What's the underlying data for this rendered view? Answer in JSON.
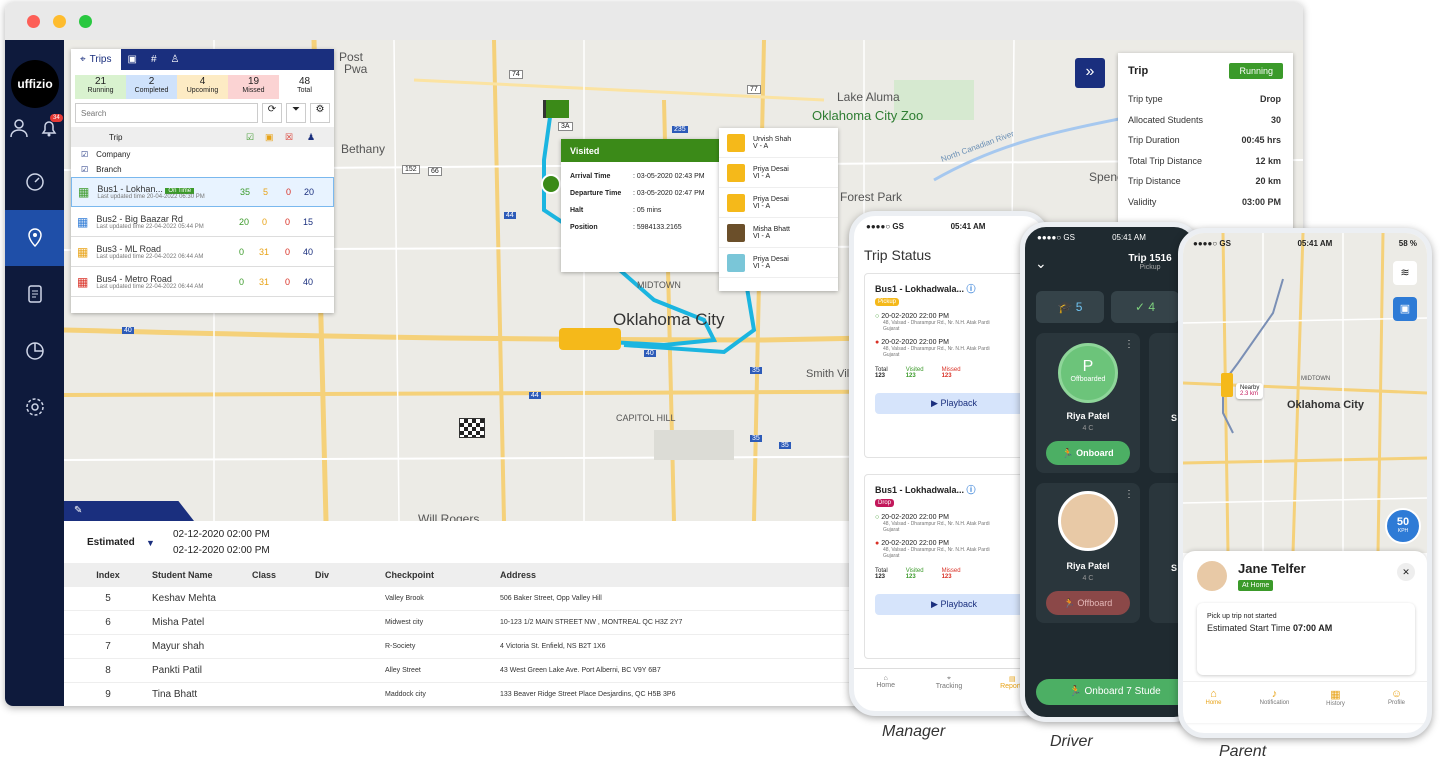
{
  "brand": {
    "name": "uffizio"
  },
  "sidebar": {
    "alerts_count": "34"
  },
  "trips_panel": {
    "tab": "Trips",
    "stats": [
      {
        "value": "21",
        "label": "Running",
        "bg": "#d9f2cf"
      },
      {
        "value": "2",
        "label": "Completed",
        "bg": "#cfe2fb"
      },
      {
        "value": "4",
        "label": "Upcoming",
        "bg": "#fdebc4"
      },
      {
        "value": "19",
        "label": "Missed",
        "bg": "#fbd3d3"
      },
      {
        "value": "48",
        "label": "Total",
        "bg": "#ffffff"
      }
    ],
    "search_placeholder": "Search",
    "col_trip": "Trip",
    "group1": "Company",
    "group2": "Branch",
    "trips": [
      {
        "name": "Bus1 - Lokhan...",
        "badge": "On Time",
        "updated": "Last updated time  20-04-2022 06:30 PM",
        "v": "35",
        "u": "5",
        "m": "0",
        "t": "20",
        "color": "#3b9a2a"
      },
      {
        "name": "Bus2 - Big Baazar Rd",
        "updated": "Last updated time  22-04-2022 05:44 PM",
        "v": "20",
        "u": "0",
        "m": "0",
        "t": "15",
        "color": "#2e7bd6"
      },
      {
        "name": "Bus3 - ML Road",
        "updated": "Last updated time  22-04-2022 06:44 AM",
        "v": "0",
        "u": "31",
        "m": "0",
        "t": "40",
        "color": "#e8a317"
      },
      {
        "name": "Bus4 - Metro Road",
        "updated": "Last updated time  22-04-2022 06:44 AM",
        "v": "0",
        "u": "31",
        "m": "0",
        "t": "40",
        "color": "#d93025"
      }
    ]
  },
  "map": {
    "labels": [
      "Post",
      "Pwa",
      "Lake Aluma",
      "Oklahoma City Zoo",
      "Bethany",
      "North Canadian River",
      "Spencer",
      "Forest Park",
      "MIDTOWN",
      "Oklahoma City",
      "Smith Villa",
      "CAPITOL HILL",
      "Will Rogers"
    ],
    "shields": [
      "74",
      "77",
      "44",
      "3A",
      "235",
      "152",
      "66",
      "62",
      "40",
      "44",
      "40",
      "35",
      "40",
      "35",
      "35"
    ]
  },
  "visited": {
    "title": "Visited",
    "rows": [
      {
        "k": "Arrival Time",
        "v": ": 03-05-2020 02:43 PM"
      },
      {
        "k": "Departure Time",
        "v": ": 03-05-2020 02:47 PM"
      },
      {
        "k": "Halt",
        "v": ": 05 mins"
      },
      {
        "k": "Position",
        "v": ": 5984133.2165"
      }
    ]
  },
  "students_popup": [
    {
      "name": "Urvish Shah",
      "cls": "V - A"
    },
    {
      "name": "Priya Desai",
      "cls": "VI - A"
    },
    {
      "name": "Priya Desai",
      "cls": "VI - A"
    },
    {
      "name": "Misha Bhatt",
      "cls": "VI - A"
    },
    {
      "name": "Priya Desai",
      "cls": "VI - A"
    }
  ],
  "trip_info": {
    "title": "Trip",
    "status": "Running",
    "rows": [
      {
        "k": "Trip type",
        "v": "Drop"
      },
      {
        "k": "Allocated Students",
        "v": "30"
      },
      {
        "k": "Trip Duration",
        "v": "00:45 hrs"
      },
      {
        "k": "Total Trip Distance",
        "v": "12 km"
      },
      {
        "k": "Trip Distance",
        "v": "20 km"
      },
      {
        "k": "Validity",
        "v": "03:00 PM"
      }
    ]
  },
  "bottom": {
    "estimated": "Estimated",
    "time1": "02-12-2020 02:00 PM",
    "time2": "02-12-2020 02:00 PM",
    "headers": [
      "Index",
      "Student Name",
      "Class",
      "Div",
      "Checkpoint",
      "Address"
    ],
    "rows": [
      {
        "i": "5",
        "n": "Keshav Mehta",
        "cp": "Valley Brook",
        "a": "506 Baker Street, Opp Valley Hill"
      },
      {
        "i": "6",
        "n": "Misha Patel",
        "cp": "Midwest city",
        "a": "10-123 1/2 MAIN STREET NW , MONTREAL QC  H3Z 2Y7"
      },
      {
        "i": "7",
        "n": "Mayur shah",
        "cp": "R-Society",
        "a": "4 Victoria St. Enfield, NS B2T 1X6"
      },
      {
        "i": "8",
        "n": "Pankti Patil",
        "cp": "Alley Street",
        "a": "43 West Green Lake Ave. Port Alberni, BC V9Y 6B7"
      },
      {
        "i": "9",
        "n": "Tina Bhatt",
        "cp": "Maddock city",
        "a": "133 Beaver Ridge Street Place Desjardins, QC H5B 3P6"
      }
    ]
  },
  "manager": {
    "carrier": "●●●●○ GS",
    "time": "05:41 AM",
    "title": "Trip Status",
    "cards": [
      {
        "name": "Bus1 - Lokhadwala...",
        "tag": "Pickup",
        "tag_color": "#f5b91a",
        "t1": "20-02-2020 22:00 PM",
        "a1": "48, Valsad - Dharampur Rd., Nr. N.H. Atak Pardi",
        "g1": "Gujarat",
        "t2": "20-02-2020 22:00 PM",
        "a2": "48, Valsad - Dharampur Rd., Nr. N.H. Atak Pardi",
        "g2": "Gujarat",
        "total_l": "Total",
        "total": "123",
        "vis_l": "Visited",
        "vis": "123",
        "mis_l": "Missed",
        "mis": "123",
        "btn": "Playback"
      },
      {
        "name": "Bus1 - Lokhadwala...",
        "tag": "Drop",
        "tag_color": "#c2185b",
        "t1": "20-02-2020 22:00 PM",
        "a1": "48, Valsad - Dharampur Rd., Nr. N.H. Atak Pardi",
        "g1": "Gujarat",
        "t2": "20-02-2020 22:00 PM",
        "a2": "48, Valsad - Dharampur Rd., Nr. N.H. Atak Pardi",
        "g2": "Gujarat",
        "total_l": "Total",
        "total": "123",
        "vis_l": "Visited",
        "vis": "123",
        "mis_l": "Missed",
        "mis": "123",
        "btn": "Playback"
      }
    ],
    "nav": [
      "Home",
      "Tracking",
      "Reports"
    ],
    "caption": "Manager"
  },
  "driver": {
    "carrier": "●●●●○ GS",
    "time": "05:41 AM",
    "title": "Trip 1516",
    "subtitle": "Pickup",
    "count1": "5",
    "count2": "4",
    "s1": {
      "initial": "P",
      "status": "Offboarded",
      "name": "Riya Patel",
      "cls": "4 C",
      "btn": "Onboard"
    },
    "s2": {
      "name": "Riya Patel",
      "cls": "4 C",
      "btn": "Offboard"
    },
    "partial": "S",
    "bottom_btn": "Onboard 7 Stude",
    "caption": "Driver"
  },
  "parent": {
    "carrier": "●●●●○ GS",
    "time": "05:41 AM",
    "battery": "58 %",
    "map_label": "Oklahoma City",
    "midtown": "MIDTOWN",
    "nearby": "Nearby",
    "nearby_dist": "2.3 km",
    "speed": "50",
    "speed_unit": "KPH",
    "name": "Jane Telfer",
    "place": "At Home",
    "msg": "Pick up trip not started",
    "est_label": "Estimated Start Time",
    "est_time": "07:00 AM",
    "nav": [
      "Home",
      "Notification",
      "History",
      "Profile"
    ],
    "caption": "Parent"
  },
  "colors": {
    "navy": "#0e1a3c",
    "accent": "#1a2f7e",
    "route": "#1bb5e0",
    "green": "#4caf64"
  }
}
